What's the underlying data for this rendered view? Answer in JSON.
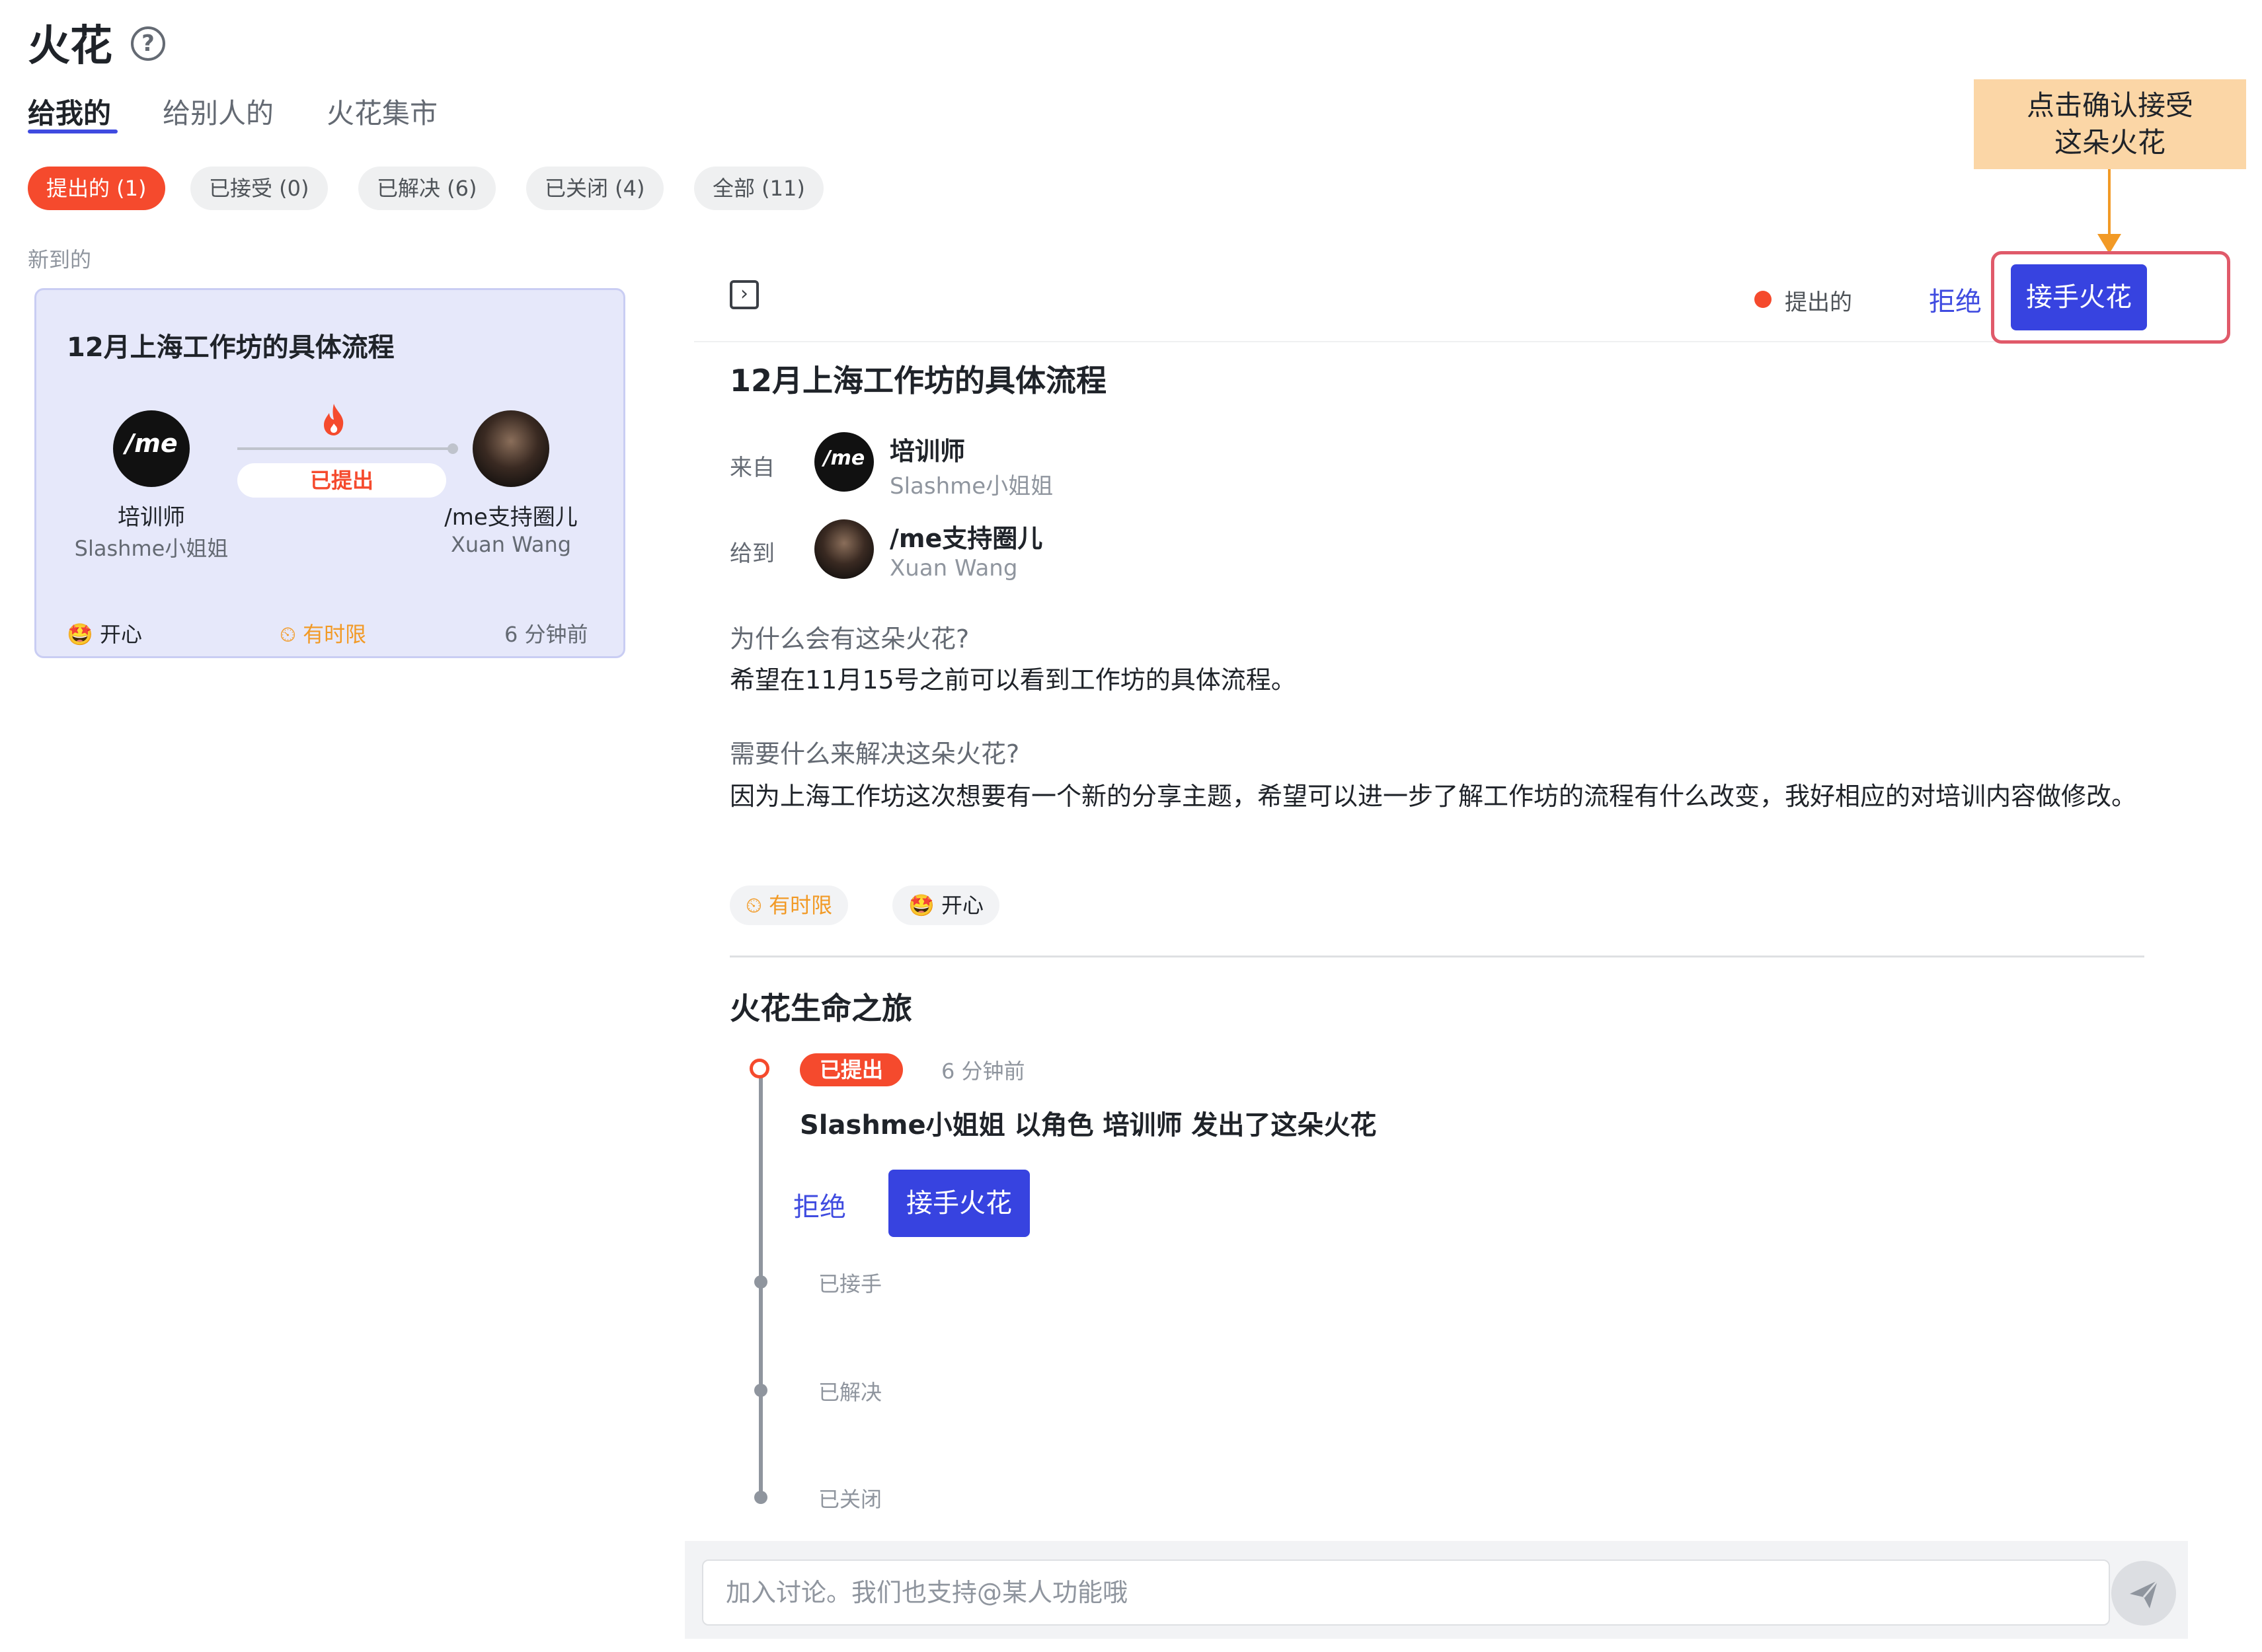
{
  "header": {
    "title": "火花",
    "help_icon": "?",
    "tabs": [
      {
        "label": "给我的",
        "active": true
      },
      {
        "label": "给别人的",
        "active": false
      },
      {
        "label": "火花集市",
        "active": false
      }
    ]
  },
  "filters": [
    {
      "label": "提出的 (1)",
      "active": true
    },
    {
      "label": "已接受 (0)",
      "active": false
    },
    {
      "label": "已解决 (6)",
      "active": false
    },
    {
      "label": "已关闭 (4)",
      "active": false
    },
    {
      "label": "全部 (11)",
      "active": false
    }
  ],
  "list": {
    "section_label": "新到的",
    "card": {
      "title": "12月上海工作坊的具体流程",
      "from": {
        "avatar_text": "/me",
        "name": "培训师",
        "sub": "Slashme小姐姐"
      },
      "to": {
        "name": "/me支持圈儿",
        "sub": "Xuan Wang"
      },
      "status": "已提出",
      "mood": "开心",
      "deadline": "有时限",
      "time": "6 分钟前"
    }
  },
  "detail": {
    "toolbar": {
      "status": "提出的",
      "reject_label": "拒绝",
      "accept_label": "接手火花"
    },
    "title": "12月上海工作坊的具体流程",
    "from_label": "来自",
    "from": {
      "avatar_text": "/me",
      "name": "培训师",
      "sub": "Slashme小姐姐"
    },
    "to_label": "给到",
    "to": {
      "name": "/me支持圈儿",
      "sub": "Xuan Wang"
    },
    "why_label": "为什么会有这朵火花?",
    "why_text": "希望在11月15号之前可以看到工作坊的具体流程。",
    "need_label": "需要什么来解决这朵火花?",
    "need_text": "因为上海工作坊这次想要有一个新的分享主题，希望可以进一步了解工作坊的流程有什么改变，我好相应的对培训内容做修改。",
    "tags": {
      "deadline": "有时限",
      "mood": "开心"
    }
  },
  "journey": {
    "title": "火花生命之旅",
    "badge": "已提出",
    "time": "6 分钟前",
    "description": "Slashme小姐姐 以角色 培训师 发出了这朵火花",
    "reject_label": "拒绝",
    "accept_label": "接手火花",
    "stages": [
      "已接手",
      "已解决",
      "已关闭"
    ]
  },
  "annotation": {
    "text_line1": "点击确认接受",
    "text_line2": "这朵火花"
  },
  "discussion": {
    "placeholder": "加入讨论。我们也支持@某人功能哦"
  },
  "colors": {
    "accent": "#3743e0",
    "status_red": "#f54a2d",
    "orange": "#f29a26",
    "card_bg": "#e6e8fa",
    "annotation_bg": "#fbd6a6"
  },
  "icons": {
    "help": "question-circle-icon",
    "fire": "fire-icon",
    "collapse": "expand-panel-icon",
    "mood": "star-struck-emoji-icon",
    "deadline": "timer-icon",
    "send": "send-icon"
  }
}
